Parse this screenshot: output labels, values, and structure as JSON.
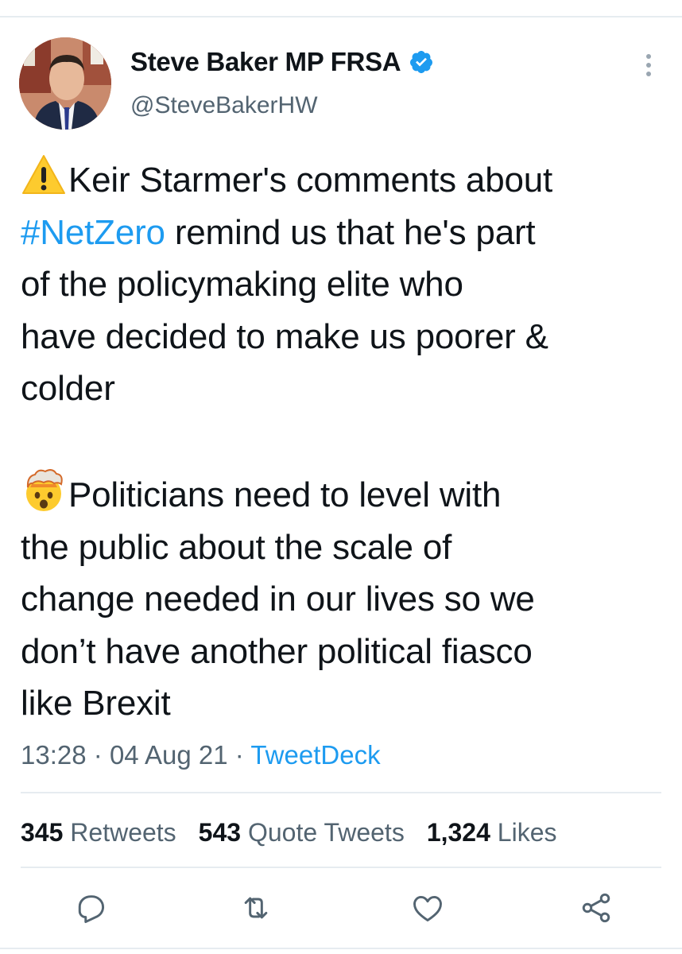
{
  "tweet": {
    "author": {
      "display_name": "Steve Baker MP FRSA",
      "handle": "@SteveBakerHW",
      "verified": true
    },
    "text_lines_paragraph1": [
      "Keir Starmer's comments about",
      "#NetZero",
      " remind us that he's part",
      "of the policymaking elite who",
      "have decided to make us poorer &",
      "colder"
    ],
    "text_lines_paragraph2": [
      "Politicians need to level with",
      "the public about the scale of",
      "change needed in our lives so we",
      "don’t have another political fiasco",
      "like Brexit"
    ],
    "emoji": {
      "paragraph1": "warning-emoji",
      "paragraph2": "exploding-head-emoji"
    },
    "time": "13:28",
    "date": "04 Aug 21",
    "separator": "·",
    "source": "TweetDeck"
  },
  "stats": {
    "retweets_count": "345",
    "retweets_label": "Retweets",
    "quotes_count": "543",
    "quotes_label": "Quote Tweets",
    "likes_count": "1,324",
    "likes_label": "Likes"
  },
  "icons": {
    "more": "more-vertical-icon",
    "reply": "reply-icon",
    "retweet": "retweet-icon",
    "like": "heart-icon",
    "share": "share-icon"
  },
  "colors": {
    "text": "#0f1419",
    "secondary": "#536471",
    "link": "#1d9bf0",
    "verified": "#1d9bf0",
    "divider": "#e6ecf0"
  }
}
